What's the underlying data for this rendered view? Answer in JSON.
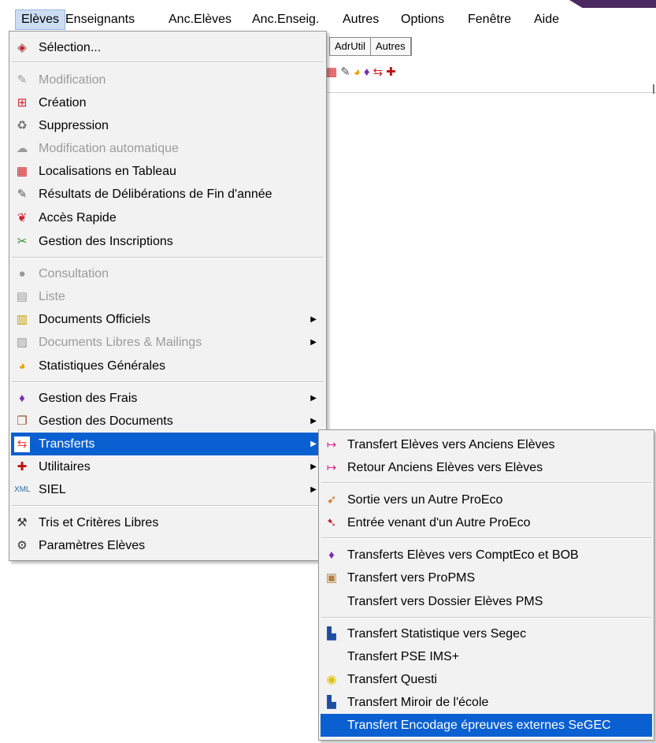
{
  "menubar": {
    "items": [
      "Elèves",
      "Enseignants",
      "Anc.Elèves",
      "Anc.Enseig.",
      "Autres",
      "Options",
      "Fenêtre",
      "Aide"
    ]
  },
  "background": {
    "tabs": [
      "AdrUtil",
      "Autres"
    ]
  },
  "main_menu": {
    "items": [
      {
        "label": "Sélection...",
        "icon": "eraser-icon",
        "disabled": false
      },
      {
        "label": "Modification",
        "icon": "edit-icon",
        "disabled": true
      },
      {
        "label": "Création",
        "icon": "create-icon",
        "disabled": false
      },
      {
        "label": "Suppression",
        "icon": "trash-icon",
        "disabled": false
      },
      {
        "label": "Modification automatique",
        "icon": "auto-edit-icon",
        "disabled": true
      },
      {
        "label": "Localisations en Tableau",
        "icon": "grid-icon",
        "disabled": false
      },
      {
        "label": "Résultats de Délibérations de Fin d'année",
        "icon": "book-icon",
        "disabled": false
      },
      {
        "label": "Accès Rapide",
        "icon": "rabbit-icon",
        "disabled": false
      },
      {
        "label": "Gestion des Inscriptions",
        "icon": "inscription-icon",
        "disabled": false
      },
      {
        "label": "Consultation",
        "icon": "eye-icon",
        "disabled": true
      },
      {
        "label": "Liste",
        "icon": "list-icon",
        "disabled": true
      },
      {
        "label": "Documents Officiels",
        "icon": "documents-icon",
        "disabled": false,
        "submenu": true
      },
      {
        "label": "Documents Libres  & Mailings",
        "icon": "mailing-icon",
        "disabled": true,
        "submenu": true
      },
      {
        "label": "Statistiques Générales",
        "icon": "pie-chart-icon",
        "disabled": false
      },
      {
        "label": "Gestion des Frais",
        "icon": "money-bag-icon",
        "disabled": false,
        "submenu": true
      },
      {
        "label": "Gestion des Documents",
        "icon": "folder-docs-icon",
        "disabled": false,
        "submenu": true
      },
      {
        "label": "Transferts",
        "icon": "transfer-arrows-icon",
        "disabled": false,
        "submenu": true,
        "highlighted": true
      },
      {
        "label": "Utilitaires",
        "icon": "tools-icon",
        "disabled": false,
        "submenu": true
      },
      {
        "label": "SIEL",
        "icon": "xml-icon",
        "disabled": false,
        "submenu": true
      },
      {
        "label": "Tris et Critères Libres",
        "icon": "sort-criteria-icon",
        "disabled": false
      },
      {
        "label": "Paramètres Elèves",
        "icon": "settings-icon",
        "disabled": false
      }
    ]
  },
  "transferts_menu": {
    "items": [
      {
        "label": "Transfert Elèves vers Anciens Elèves",
        "icon": "arrow-right-icon"
      },
      {
        "label": "Retour Anciens Elèves vers Elèves",
        "icon": "arrow-right-icon"
      },
      {
        "label": "Sortie vers un Autre ProEco",
        "icon": "export-icon"
      },
      {
        "label": "Entrée venant d'un Autre ProEco",
        "icon": "import-icon"
      },
      {
        "label": "Transferts Elèves vers ComptEco et BOB",
        "icon": "money-bag-icon"
      },
      {
        "label": "Transfert vers ProPMS",
        "icon": "pms-icon"
      },
      {
        "label": "Transfert vers Dossier Elèves PMS",
        "icon": ""
      },
      {
        "label": "Transfert Statistique vers Segec",
        "icon": "stats-icon"
      },
      {
        "label": "Transfert PSE IMS+",
        "icon": ""
      },
      {
        "label": "Transfert Questi",
        "icon": "questi-icon"
      },
      {
        "label": "Transfert Miroir de l'école",
        "icon": "stats-icon"
      },
      {
        "label": "Transfert Encodage épreuves externes SeGEC",
        "icon": "",
        "highlighted": true
      }
    ]
  }
}
